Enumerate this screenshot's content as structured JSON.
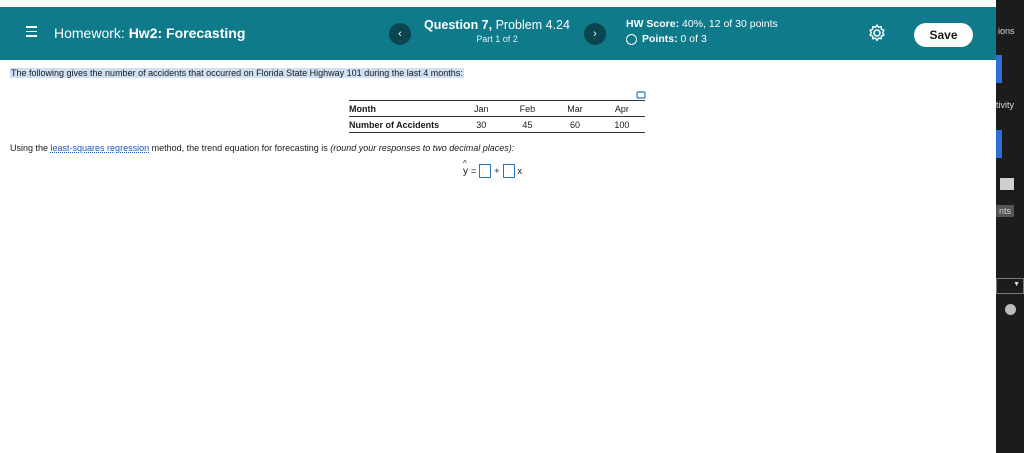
{
  "header": {
    "hw_prefix": "Homework:",
    "hw_name": "Hw2: Forecasting",
    "question_number": "Question 7,",
    "problem": "Problem 4.24",
    "part": "Part 1 of 2",
    "prev_icon": "chevron-left-icon",
    "next_icon": "chevron-right-icon",
    "hw_score_label": "HW Score:",
    "hw_score_value": "40%, 12 of 30 points",
    "points_label": "Points:",
    "points_value": "0 of 3",
    "save_label": "Save",
    "accent_color": "#0e7a8a"
  },
  "side": {
    "t1": "ions",
    "t2": "tivity",
    "t3": "nts"
  },
  "problem": {
    "intro": "The following gives the number of accidents that occurred on Florida State Highway 101 during the last 4 months:",
    "table": {
      "row_labels": [
        "Month",
        "Number of Accidents"
      ],
      "months": [
        "Jan",
        "Feb",
        "Mar",
        "Apr"
      ],
      "accidents": [
        "30",
        "45",
        "60",
        "100"
      ]
    },
    "instruction_pre": "Using the ",
    "instruction_link": "least-squares regression",
    "instruction_mid": " method, the trend equation for forecasting is ",
    "instruction_italic": "(round your responses to two decimal places):",
    "eq_y": "y",
    "eq_equals": "=",
    "eq_plus": "+",
    "eq_x": "x"
  }
}
